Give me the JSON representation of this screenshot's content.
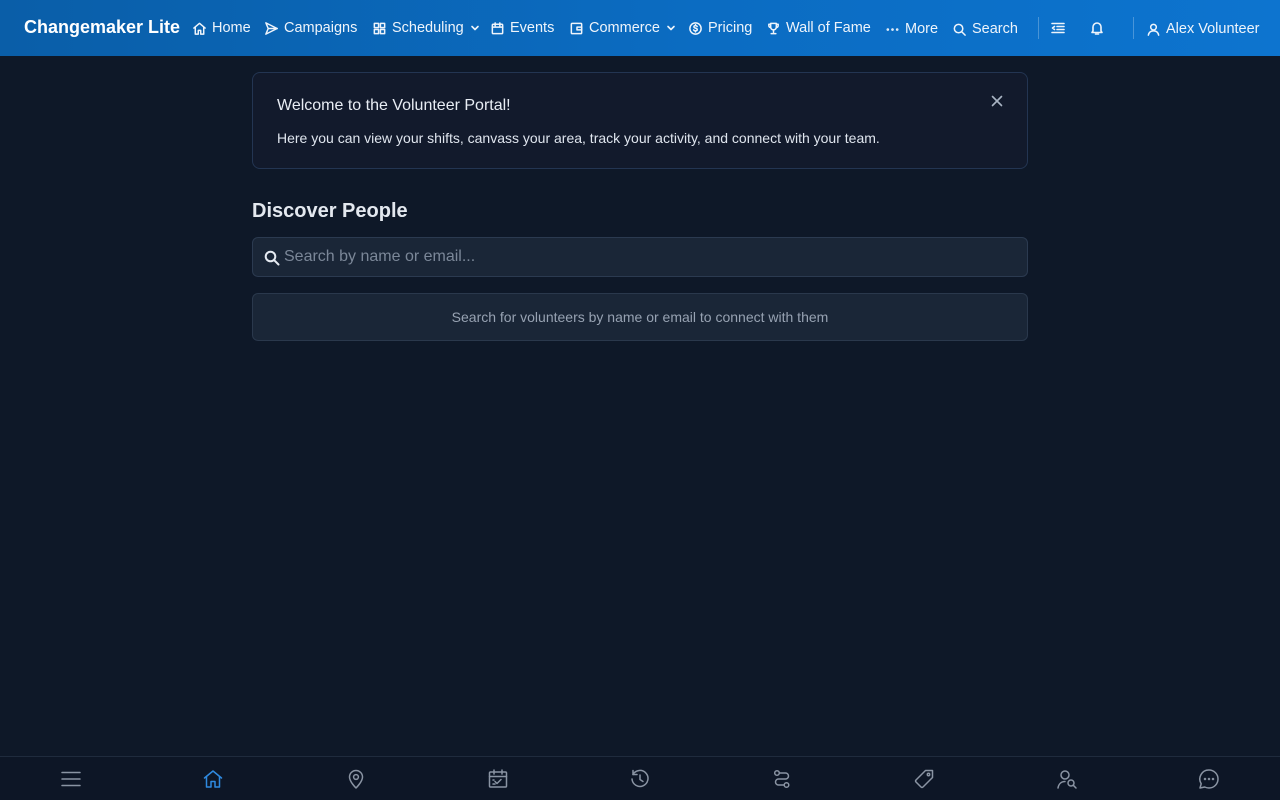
{
  "app": {
    "brand": "Changemaker Lite"
  },
  "nav": {
    "items": [
      {
        "label": "Home",
        "icon": "home-icon"
      },
      {
        "label": "Campaigns",
        "icon": "send-icon"
      },
      {
        "label": "Scheduling",
        "icon": "grid-icon",
        "has_dropdown": true
      },
      {
        "label": "Events",
        "icon": "calendar-icon"
      },
      {
        "label": "Commerce",
        "icon": "wallet-icon",
        "has_dropdown": true
      },
      {
        "label": "Pricing",
        "icon": "dollar-circle-icon"
      },
      {
        "label": "Wall of Fame",
        "icon": "trophy-icon"
      },
      {
        "label": "More",
        "icon": "ellipsis-icon"
      },
      {
        "label": "Search",
        "icon": "search-icon"
      }
    ],
    "user_name": "Alex Volunteer"
  },
  "banner": {
    "title": "Welcome to the Volunteer Portal!",
    "text": "Here you can view your shifts, canvass your area, track your activity, and connect with your team."
  },
  "discover": {
    "title": "Discover People",
    "search_placeholder": "Search by name or email...",
    "search_value": "",
    "empty_text": "Search for volunteers by name or email to connect with them"
  },
  "bottom_nav": {
    "items": [
      {
        "icon": "menu-icon"
      },
      {
        "icon": "home-icon",
        "active": true
      },
      {
        "icon": "map-pin-icon"
      },
      {
        "icon": "calendar-check-icon"
      },
      {
        "icon": "history-icon"
      },
      {
        "icon": "route-icon"
      },
      {
        "icon": "tag-icon"
      },
      {
        "icon": "user-search-icon"
      },
      {
        "icon": "chat-icon"
      }
    ]
  },
  "colors": {
    "header_start": "#0a5ea8",
    "header_end": "#0d74cf",
    "background": "#0e1828",
    "accent": "#2f8ae0"
  }
}
